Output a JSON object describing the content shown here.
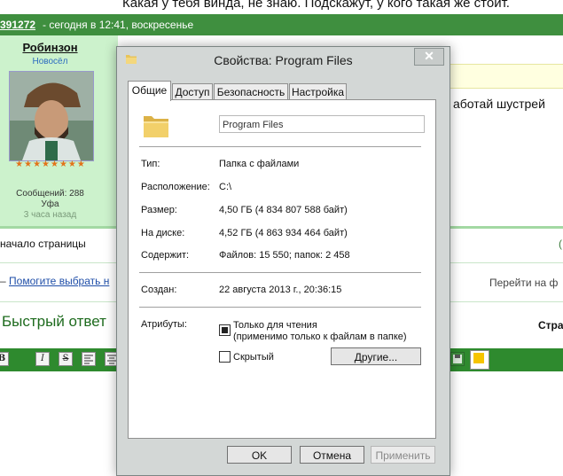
{
  "forum": {
    "top_text": "Какая у тебя винда, не знаю. Подскажут, у кого такая же стоит.",
    "post_number": "391272",
    "post_date": " - сегодня в 12:41, воскресенье",
    "user": {
      "name": "Робинзон",
      "rank": "Новосёл",
      "stars": "★★★★★★★★",
      "posts": "Сообщений: 288",
      "city": "Уфа",
      "last_seen": "3 часа назад"
    },
    "post_text": "аботай шустрей",
    "top_link": "начало страницы",
    "right_char": "(",
    "nav_prefix": "– ",
    "nav_link": "Помогите выбрать н",
    "goto_label": "Перейти на ф",
    "quick_reply": "Быстрый ответ",
    "page_label": "Стра",
    "toolbar_icons": [
      "bold-icon",
      "italic-icon",
      "strike-icon",
      "align-left-icon",
      "align-center-icon",
      "save-icon",
      "color-icon"
    ]
  },
  "dialog": {
    "title": "Свойства: Program Files",
    "close_symbol": "✕",
    "tabs": [
      "Общие",
      "Доступ",
      "Безопасность",
      "Настройка"
    ],
    "folder_name": "Program Files",
    "rows": [
      {
        "label": "Тип:",
        "value": "Папка с файлами"
      },
      {
        "label": "Расположение:",
        "value": "C:\\"
      },
      {
        "label": "Размер:",
        "value": "4,50 ГБ (4 834 807 588 байт)"
      },
      {
        "label": "На диске:",
        "value": "4,52 ГБ (4 863 934 464 байт)"
      },
      {
        "label": "Содержит:",
        "value": "Файлов: 15 550; папок: 2 458"
      }
    ],
    "created_label": "Создан:",
    "created_value": "22 августа 2013 г., 20:36:15",
    "attributes_label": "Атрибуты:",
    "readonly_label": "Только для чтения",
    "readonly_note": "(применимо только к файлам в папке)",
    "hidden_label": "Скрытый",
    "other_button": "Другие...",
    "ok_button": "OK",
    "cancel_button": "Отмена",
    "apply_button": "Применить"
  }
}
